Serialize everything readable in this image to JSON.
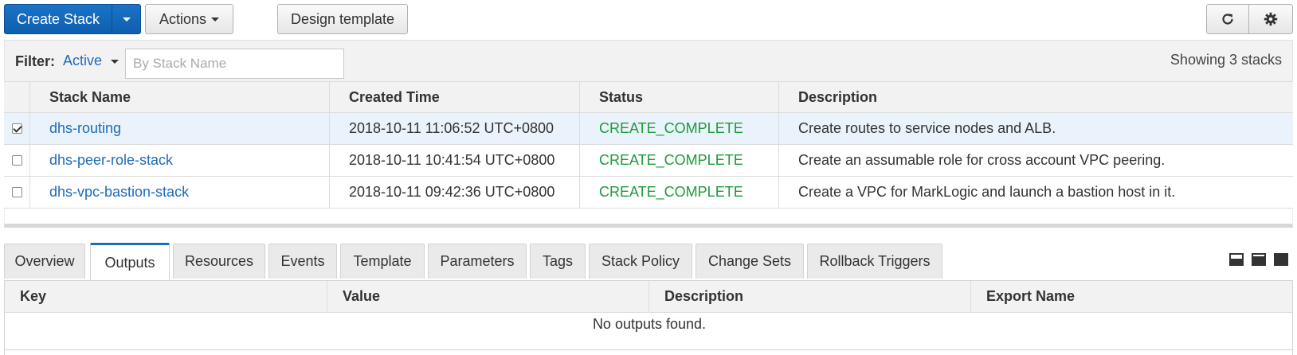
{
  "toolbar": {
    "create_label": "Create Stack",
    "actions_label": "Actions",
    "design_label": "Design template",
    "refresh_icon": "refresh-icon",
    "settings_icon": "gear-icon"
  },
  "filter": {
    "label": "Filter:",
    "active_value": "Active",
    "placeholder": "By Stack Name",
    "showing": "Showing 3 stacks"
  },
  "stacks": {
    "headers": [
      "Stack Name",
      "Created Time",
      "Status",
      "Description"
    ],
    "rows": [
      {
        "checked": true,
        "name": "dhs-routing",
        "created": "2018-10-11 11:06:52 UTC+0800",
        "status": "CREATE_COMPLETE",
        "description": "Create routes to service nodes and ALB."
      },
      {
        "checked": false,
        "name": "dhs-peer-role-stack",
        "created": "2018-10-11 10:41:54 UTC+0800",
        "status": "CREATE_COMPLETE",
        "description": "Create an assumable role for cross account VPC peering."
      },
      {
        "checked": false,
        "name": "dhs-vpc-bastion-stack",
        "created": "2018-10-11 09:42:36 UTC+0800",
        "status": "CREATE_COMPLETE",
        "description": "Create a VPC for MarkLogic and launch a bastion host in it."
      }
    ]
  },
  "tabs": [
    "Overview",
    "Outputs",
    "Resources",
    "Events",
    "Template",
    "Parameters",
    "Tags",
    "Stack Policy",
    "Change Sets",
    "Rollback Triggers"
  ],
  "active_tab": "Outputs",
  "outputs": {
    "headers": [
      "Key",
      "Value",
      "Description",
      "Export Name"
    ],
    "empty_message": "No outputs found."
  },
  "colors": {
    "primary": "#0f5fae",
    "link": "#1e6bb8",
    "status_ok": "#1d9b3a"
  }
}
